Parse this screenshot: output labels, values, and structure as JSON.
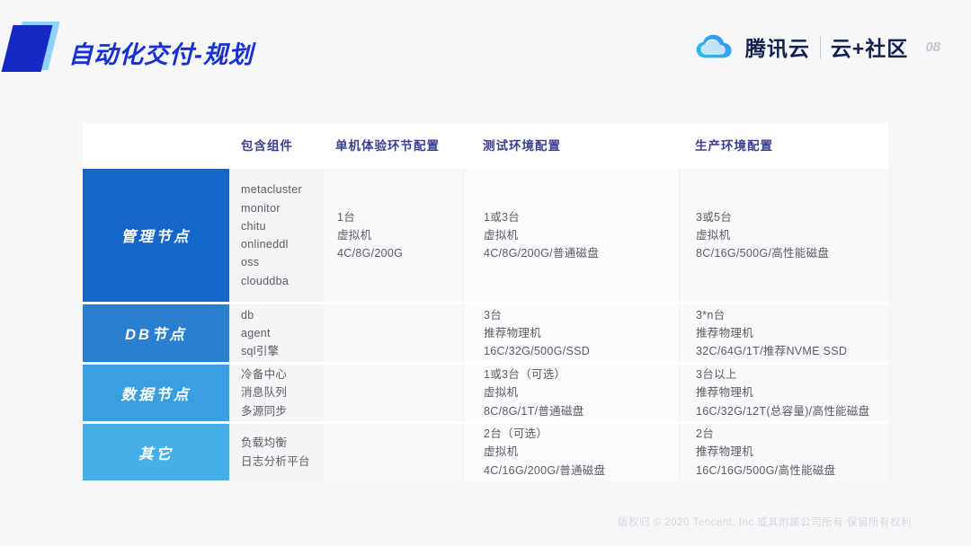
{
  "slide": {
    "title": "自动化交付-规划",
    "page_number": "08",
    "copyright": "版权归 © 2020 Tencent, Inc.或其附属公司所有 保留所有权利"
  },
  "brand": {
    "name": "腾讯云",
    "community": "云+社区",
    "logo_blue": "#3f8cf3",
    "logo_teal": "#29c1e9"
  },
  "theme": {
    "title_blue": "#1730d2",
    "ribbon_blue": "#1628c4",
    "ribbon_accent": "#8fd2f8",
    "header_text": "#3a3f91"
  },
  "table": {
    "columns": [
      "包含组件",
      "单机体验环节配置",
      "测试环境配置",
      "生产环境配置"
    ],
    "rows": [
      {
        "name": "管理节点",
        "color": "#1466c8",
        "components": [
          "metacluster",
          "monitor",
          "chitu",
          "onlineddl",
          "oss",
          "clouddba"
        ],
        "single": [
          "1台",
          "虚拟机",
          "4C/8G/200G"
        ],
        "test": [
          "1或3台",
          "虚拟机",
          "4C/8G/200G/普通磁盘"
        ],
        "prod": [
          "3或5台",
          "虚拟机",
          "8C/16G/500G/高性能磁盘"
        ]
      },
      {
        "name": "DB节点",
        "color": "#2a7fd1",
        "components": [
          "db",
          "agent",
          "sql引擎"
        ],
        "single": [],
        "test": [
          "3台",
          "推荐物理机",
          "16C/32G/500G/SSD"
        ],
        "prod": [
          "3*n台",
          "推荐物理机",
          "32C/64G/1T/推荐NVME  SSD"
        ]
      },
      {
        "name": "数据节点",
        "color": "#38a0e0",
        "components": [
          "冷备中心",
          "消息队列",
          "多源同步"
        ],
        "single": [],
        "test": [
          "1或3台（可选）",
          "虚拟机",
          "8C/8G/1T/普通磁盘"
        ],
        "prod": [
          "3台以上",
          "推荐物理机",
          "16C/32G/12T(总容量)/高性能磁盘"
        ]
      },
      {
        "name": "其它",
        "color": "#45b0e7",
        "components": [
          "负载均衡",
          "日志分析平台"
        ],
        "single": [],
        "test": [
          "2台（可选）",
          "虚拟机",
          "4C/16G/200G/普通磁盘"
        ],
        "prod": [
          "2台",
          "推荐物理机",
          "16C/16G/500G/高性能磁盘"
        ]
      }
    ]
  }
}
